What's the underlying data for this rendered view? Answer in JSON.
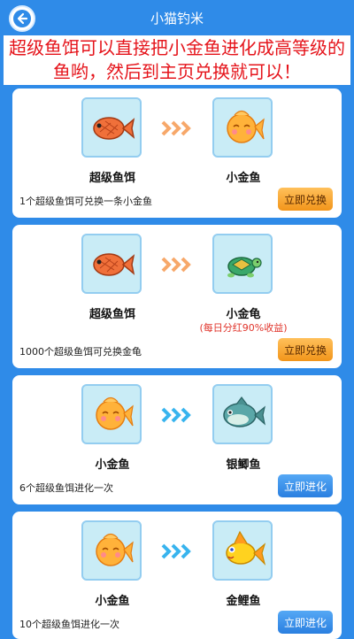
{
  "header": {
    "title": "小猫钓米"
  },
  "notice": {
    "text": "超级鱼饵可以直接把小金鱼进化成高等级的鱼哟，然后到主页兑换就可以！"
  },
  "cards": [
    {
      "from": "超级鱼饵",
      "to": "小金鱼",
      "sub": "",
      "desc": "1个超级鱼饵可兑换一条小金鱼",
      "button": "立即兑换"
    },
    {
      "from": "超级鱼饵",
      "to": "小金龟",
      "sub": "(每日分红90%收益)",
      "desc": "1000个超级鱼饵可兑换金龟",
      "button": "立即兑换"
    },
    {
      "from": "小金鱼",
      "to": "银鲫鱼",
      "sub": "",
      "desc": "6个超级鱼饵进化一次",
      "button": "立即进化"
    },
    {
      "from": "小金鱼",
      "to": "金鲤鱼",
      "sub": "",
      "desc": "10个超级鱼饵进化一次",
      "button": "立即进化"
    }
  ],
  "colors": {
    "background": "#2f8be8",
    "accent_orange": "#f2951a",
    "accent_blue": "#2a7fe0",
    "notice_red": "#e5141b"
  },
  "icons": [
    "back-arrow-icon",
    "bait-fish-icon",
    "goldfish-icon",
    "turtle-icon",
    "silver-carp-icon",
    "golden-carp-icon",
    "chevrons-right-icon"
  ]
}
